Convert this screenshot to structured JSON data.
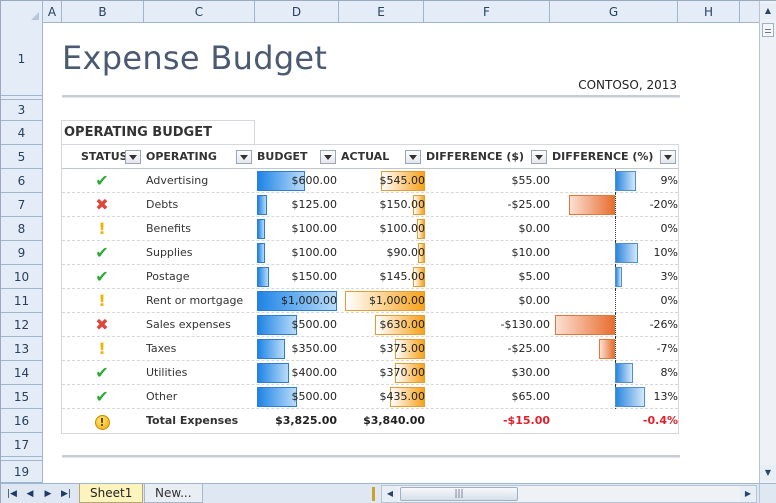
{
  "columns": [
    "A",
    "B",
    "C",
    "D",
    "E",
    "F",
    "G",
    "H"
  ],
  "rows": [
    "1",
    "3",
    "4",
    "5",
    "6",
    "7",
    "8",
    "9",
    "10",
    "11",
    "12",
    "13",
    "14",
    "15",
    "16",
    "17",
    "19"
  ],
  "title": "Expense Budget",
  "subtitle": "CONTOSO, 2013",
  "section_title": "OPERATING BUDGET",
  "headers": {
    "status": "STATUS",
    "operating": "OPERATING",
    "budget": "BUDGET",
    "actual": "ACTUAL",
    "difference": "DIFFERENCE ($)",
    "difference_pct": "DIFFERENCE (%)"
  },
  "items": [
    {
      "status": "ok",
      "icon": "check-icon",
      "name": "Advertising",
      "budget": "$600.00",
      "budget_frac": 0.6,
      "actual": "$545.00",
      "actual_frac": 0.545,
      "diff": "$55.00",
      "diff_neg": false,
      "pct": "9%",
      "pct_val": 9
    },
    {
      "status": "bad",
      "icon": "cross-icon",
      "name": "Debts",
      "budget": "$125.00",
      "budget_frac": 0.125,
      "actual": "$150.00",
      "actual_frac": 0.15,
      "diff": "-$25.00",
      "diff_neg": false,
      "pct": "-20%",
      "pct_val": -20
    },
    {
      "status": "warn",
      "icon": "exclaim-icon",
      "name": "Benefits",
      "budget": "$100.00",
      "budget_frac": 0.1,
      "actual": "$100.00",
      "actual_frac": 0.1,
      "diff": "$0.00",
      "diff_neg": false,
      "pct": "0%",
      "pct_val": 0
    },
    {
      "status": "ok",
      "icon": "check-icon",
      "name": "Supplies",
      "budget": "$100.00",
      "budget_frac": 0.1,
      "actual": "$90.00",
      "actual_frac": 0.09,
      "diff": "$10.00",
      "diff_neg": false,
      "pct": "10%",
      "pct_val": 10
    },
    {
      "status": "ok",
      "icon": "check-icon",
      "name": "Postage",
      "budget": "$150.00",
      "budget_frac": 0.15,
      "actual": "$145.00",
      "actual_frac": 0.145,
      "diff": "$5.00",
      "diff_neg": false,
      "pct": "3%",
      "pct_val": 3
    },
    {
      "status": "warn",
      "icon": "exclaim-icon",
      "name": "Rent or mortgage",
      "budget": "$1,000.00",
      "budget_frac": 1.0,
      "actual": "$1,000.00",
      "actual_frac": 1.0,
      "diff": "$0.00",
      "diff_neg": false,
      "pct": "0%",
      "pct_val": 0
    },
    {
      "status": "bad",
      "icon": "cross-icon",
      "name": "Sales expenses",
      "budget": "$500.00",
      "budget_frac": 0.5,
      "actual": "$630.00",
      "actual_frac": 0.63,
      "diff": "-$130.00",
      "diff_neg": false,
      "pct": "-26%",
      "pct_val": -26
    },
    {
      "status": "warn",
      "icon": "exclaim-icon",
      "name": "Taxes",
      "budget": "$350.00",
      "budget_frac": 0.35,
      "actual": "$375.00",
      "actual_frac": 0.375,
      "diff": "-$25.00",
      "diff_neg": false,
      "pct": "-7%",
      "pct_val": -7
    },
    {
      "status": "ok",
      "icon": "check-icon",
      "name": "Utilities",
      "budget": "$400.00",
      "budget_frac": 0.4,
      "actual": "$370.00",
      "actual_frac": 0.37,
      "diff": "$30.00",
      "diff_neg": false,
      "pct": "8%",
      "pct_val": 8
    },
    {
      "status": "ok",
      "icon": "check-icon",
      "name": "Other",
      "budget": "$500.00",
      "budget_frac": 0.5,
      "actual": "$435.00",
      "actual_frac": 0.435,
      "diff": "$65.00",
      "diff_neg": false,
      "pct": "13%",
      "pct_val": 13
    }
  ],
  "total": {
    "icon": "total-warning-icon",
    "icon_glyph": "!",
    "name": "Total Expenses",
    "budget": "$3,825.00",
    "actual": "$3,840.00",
    "diff": "-$15.00",
    "pct": "-0.4%"
  },
  "sheet_tabs": {
    "active": "Sheet1",
    "new": "New..."
  },
  "colors": {
    "check": "#2eaa3a",
    "cross": "#e0443a",
    "exclaim": "#f0b400",
    "negative_total": "#e0202a"
  }
}
